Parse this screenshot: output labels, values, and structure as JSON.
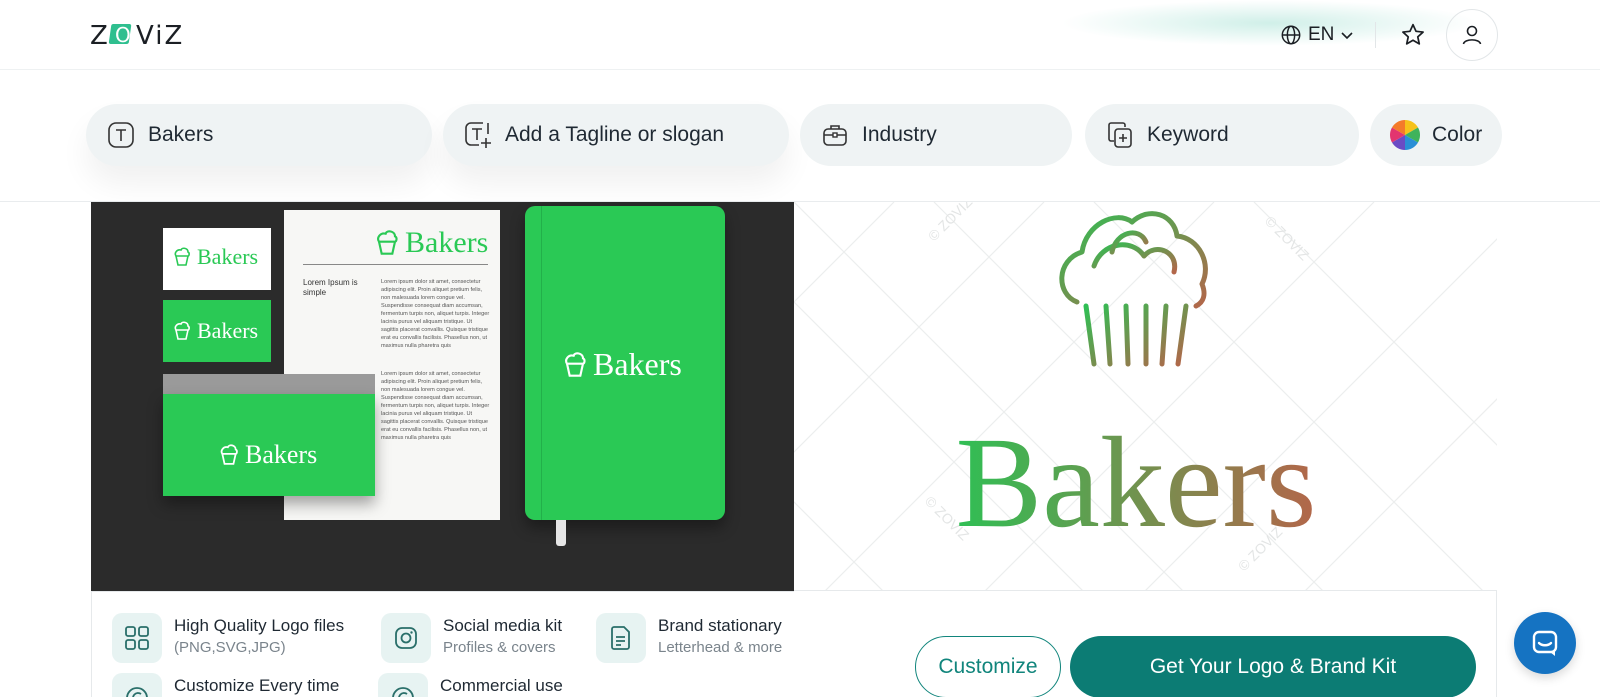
{
  "header": {
    "logo_text": "ZOVIZ",
    "language": "EN",
    "icons": [
      "globe-icon",
      "chevron-down-icon",
      "star-icon",
      "user-icon"
    ]
  },
  "inputs": {
    "name": {
      "value": "Bakers",
      "icon": "text-icon"
    },
    "tagline": {
      "placeholder": "Add a Tagline or slogan",
      "icon": "text-add-icon"
    },
    "industry": {
      "placeholder": "Industry",
      "icon": "briefcase-icon"
    },
    "keyword": {
      "placeholder": "Keyword",
      "icon": "keyword-add-icon"
    },
    "color": {
      "label": "Color",
      "icon": "color-wheel-icon"
    }
  },
  "mockup": {
    "brand": "Bakers",
    "lorem_heading": "Lorem Ipsum is simple",
    "lorem_text": "Lorem ipsum dolor sit amet, consectetur adipiscing elit. Proin aliquet pretium felis, non malesuada lorem congue vel. Suspendisse consequat diam accumsan, fermentum turpis non, aliquet turpis. Integer lacinia purus vel aliquam tristique. Ut sagittis placerat convallis. Quisque tristique erat eu convallis facilisis. Phasellus non, ut maximus nulla pharetra quis",
    "brand_color": "#2ac955"
  },
  "preview": {
    "brand": "Bakers",
    "watermark": "© ZOVIZ",
    "gradient_start": "#2fbf54",
    "gradient_end": "#b3664a"
  },
  "features": [
    {
      "title": "High Quality Logo files",
      "subtitle": "(PNG,SVG,JPG)",
      "icon": "grid-icon"
    },
    {
      "title": "Social media kit",
      "subtitle": "Profiles & covers",
      "icon": "instagram-icon"
    },
    {
      "title": "Brand stationary",
      "subtitle": "Letterhead & more",
      "icon": "document-icon"
    },
    {
      "title": "Customize Every time",
      "subtitle": "",
      "icon": "copyright-icon"
    },
    {
      "title": "Commercial use",
      "subtitle": "",
      "icon": "copyright-icon"
    }
  ],
  "actions": {
    "customize": "Customize",
    "get_kit": "Get Your Logo & Brand Kit"
  },
  "colors": {
    "accent": "#0c7c74",
    "chat": "#1573c2"
  }
}
